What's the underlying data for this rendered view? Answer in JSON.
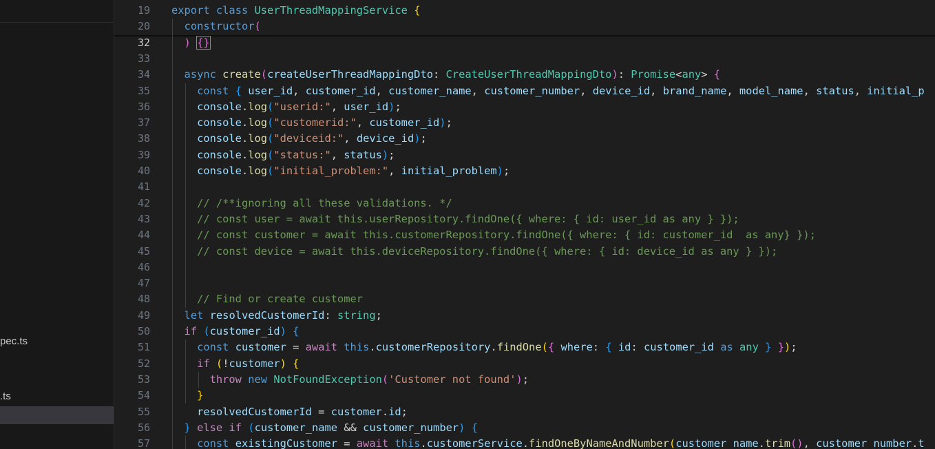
{
  "sidebar": {
    "items": [
      {
        "label": "pec.ts"
      },
      {
        "label": ".ts"
      }
    ]
  },
  "editor": {
    "lines": [
      {
        "num": "19",
        "tokens": [
          [
            "kw",
            "export"
          ],
          [
            "d",
            " "
          ],
          [
            "kw",
            "class"
          ],
          [
            "d",
            " "
          ],
          [
            "cls",
            "UserThreadMappingService"
          ],
          [
            "d",
            " "
          ],
          [
            "b1",
            "{"
          ]
        ]
      },
      {
        "num": "20",
        "tokens": [
          [
            "d",
            "  "
          ],
          [
            "kw",
            "constructor"
          ],
          [
            "b2",
            "("
          ]
        ]
      },
      {
        "num": "32",
        "active": true,
        "tokens": [
          [
            "d",
            "  "
          ],
          [
            "b2",
            ")"
          ],
          [
            "d",
            " "
          ],
          [
            "b2",
            "{}"
          ]
        ]
      },
      {
        "num": "33",
        "tokens": []
      },
      {
        "num": "34",
        "tokens": [
          [
            "d",
            "  "
          ],
          [
            "kw",
            "async"
          ],
          [
            "d",
            " "
          ],
          [
            "fn",
            "create"
          ],
          [
            "b2",
            "("
          ],
          [
            "var",
            "createUserThreadMappingDto"
          ],
          [
            "d",
            ": "
          ],
          [
            "cls",
            "CreateUserThreadMappingDto"
          ],
          [
            "b2",
            ")"
          ],
          [
            "d",
            ": "
          ],
          [
            "cls",
            "Promise"
          ],
          [
            "d",
            "<"
          ],
          [
            "cls",
            "any"
          ],
          [
            "d",
            "> "
          ],
          [
            "b2",
            "{"
          ]
        ]
      },
      {
        "num": "35",
        "tokens": [
          [
            "d",
            "    "
          ],
          [
            "kw",
            "const"
          ],
          [
            "d",
            " "
          ],
          [
            "b3",
            "{"
          ],
          [
            "d",
            " "
          ],
          [
            "var",
            "user_id"
          ],
          [
            "d",
            ", "
          ],
          [
            "var",
            "customer_id"
          ],
          [
            "d",
            ", "
          ],
          [
            "var",
            "customer_name"
          ],
          [
            "d",
            ", "
          ],
          [
            "var",
            "customer_number"
          ],
          [
            "d",
            ", "
          ],
          [
            "var",
            "device_id"
          ],
          [
            "d",
            ", "
          ],
          [
            "var",
            "brand_name"
          ],
          [
            "d",
            ", "
          ],
          [
            "var",
            "model_name"
          ],
          [
            "d",
            ", "
          ],
          [
            "var",
            "status"
          ],
          [
            "d",
            ", "
          ],
          [
            "var",
            "initial_p"
          ]
        ]
      },
      {
        "num": "36",
        "tokens": [
          [
            "d",
            "    "
          ],
          [
            "var",
            "console"
          ],
          [
            "d",
            "."
          ],
          [
            "fn",
            "log"
          ],
          [
            "b3",
            "("
          ],
          [
            "str",
            "\"userid:\""
          ],
          [
            "d",
            ", "
          ],
          [
            "var",
            "user_id"
          ],
          [
            "b3",
            ")"
          ],
          [
            "d",
            ";"
          ]
        ]
      },
      {
        "num": "37",
        "tokens": [
          [
            "d",
            "    "
          ],
          [
            "var",
            "console"
          ],
          [
            "d",
            "."
          ],
          [
            "fn",
            "log"
          ],
          [
            "b3",
            "("
          ],
          [
            "str",
            "\"customerid:\""
          ],
          [
            "d",
            ", "
          ],
          [
            "var",
            "customer_id"
          ],
          [
            "b3",
            ")"
          ],
          [
            "d",
            ";"
          ]
        ]
      },
      {
        "num": "38",
        "tokens": [
          [
            "d",
            "    "
          ],
          [
            "var",
            "console"
          ],
          [
            "d",
            "."
          ],
          [
            "fn",
            "log"
          ],
          [
            "b3",
            "("
          ],
          [
            "str",
            "\"deviceid:\""
          ],
          [
            "d",
            ", "
          ],
          [
            "var",
            "device_id"
          ],
          [
            "b3",
            ")"
          ],
          [
            "d",
            ";"
          ]
        ]
      },
      {
        "num": "39",
        "tokens": [
          [
            "d",
            "    "
          ],
          [
            "var",
            "console"
          ],
          [
            "d",
            "."
          ],
          [
            "fn",
            "log"
          ],
          [
            "b3",
            "("
          ],
          [
            "str",
            "\"status:\""
          ],
          [
            "d",
            ", "
          ],
          [
            "var",
            "status"
          ],
          [
            "b3",
            ")"
          ],
          [
            "d",
            ";"
          ]
        ]
      },
      {
        "num": "40",
        "tokens": [
          [
            "d",
            "    "
          ],
          [
            "var",
            "console"
          ],
          [
            "d",
            "."
          ],
          [
            "fn",
            "log"
          ],
          [
            "b3",
            "("
          ],
          [
            "str",
            "\"initial_problem:\""
          ],
          [
            "d",
            ", "
          ],
          [
            "var",
            "initial_problem"
          ],
          [
            "b3",
            ")"
          ],
          [
            "d",
            ";"
          ]
        ]
      },
      {
        "num": "41",
        "tokens": []
      },
      {
        "num": "42",
        "tokens": [
          [
            "d",
            "    "
          ],
          [
            "cmt",
            "// /**ignoring all these validations. */"
          ]
        ]
      },
      {
        "num": "43",
        "tokens": [
          [
            "d",
            "    "
          ],
          [
            "cmt",
            "// const user = await this.userRepository.findOne({ where: { id: user_id as any } });"
          ]
        ]
      },
      {
        "num": "44",
        "tokens": [
          [
            "d",
            "    "
          ],
          [
            "cmt",
            "// const customer = await this.customerRepository.findOne({ where: { id: customer_id  as any} });"
          ]
        ]
      },
      {
        "num": "45",
        "tokens": [
          [
            "d",
            "    "
          ],
          [
            "cmt",
            "// const device = await this.deviceRepository.findOne({ where: { id: device_id as any } });"
          ]
        ]
      },
      {
        "num": "46",
        "tokens": []
      },
      {
        "num": "47",
        "tokens": []
      },
      {
        "num": "48",
        "tokens": [
          [
            "d",
            "    "
          ],
          [
            "cmt",
            "// Find or create customer"
          ]
        ]
      },
      {
        "num": "49",
        "tokens": [
          [
            "d",
            "  "
          ],
          [
            "kw",
            "let"
          ],
          [
            "d",
            " "
          ],
          [
            "var",
            "resolvedCustomerId"
          ],
          [
            "d",
            ": "
          ],
          [
            "cls",
            "string"
          ],
          [
            "d",
            ";"
          ]
        ]
      },
      {
        "num": "50",
        "tokens": [
          [
            "d",
            "  "
          ],
          [
            "ctl",
            "if"
          ],
          [
            "d",
            " "
          ],
          [
            "b3",
            "("
          ],
          [
            "var",
            "customer_id"
          ],
          [
            "b3",
            ")"
          ],
          [
            "d",
            " "
          ],
          [
            "b3",
            "{"
          ]
        ]
      },
      {
        "num": "51",
        "tokens": [
          [
            "d",
            "    "
          ],
          [
            "kw",
            "const"
          ],
          [
            "d",
            " "
          ],
          [
            "var",
            "customer"
          ],
          [
            "d",
            " = "
          ],
          [
            "ctl",
            "await"
          ],
          [
            "d",
            " "
          ],
          [
            "kw",
            "this"
          ],
          [
            "d",
            "."
          ],
          [
            "var",
            "customerRepository"
          ],
          [
            "d",
            "."
          ],
          [
            "fn",
            "findOne"
          ],
          [
            "b1",
            "("
          ],
          [
            "b2",
            "{"
          ],
          [
            "d",
            " "
          ],
          [
            "var",
            "where"
          ],
          [
            "d",
            ": "
          ],
          [
            "b3",
            "{"
          ],
          [
            "d",
            " "
          ],
          [
            "var",
            "id"
          ],
          [
            "d",
            ": "
          ],
          [
            "var",
            "customer_id"
          ],
          [
            "d",
            " "
          ],
          [
            "kw",
            "as"
          ],
          [
            "d",
            " "
          ],
          [
            "cls",
            "any"
          ],
          [
            "d",
            " "
          ],
          [
            "b3",
            "}"
          ],
          [
            "d",
            " "
          ],
          [
            "b2",
            "}"
          ],
          [
            "b1",
            ")"
          ],
          [
            "d",
            ";"
          ]
        ]
      },
      {
        "num": "52",
        "tokens": [
          [
            "d",
            "    "
          ],
          [
            "ctl",
            "if"
          ],
          [
            "d",
            " "
          ],
          [
            "b1",
            "("
          ],
          [
            "d",
            "!"
          ],
          [
            "var",
            "customer"
          ],
          [
            "b1",
            ")"
          ],
          [
            "d",
            " "
          ],
          [
            "b1",
            "{"
          ]
        ]
      },
      {
        "num": "53",
        "tokens": [
          [
            "d",
            "      "
          ],
          [
            "ctl",
            "throw"
          ],
          [
            "d",
            " "
          ],
          [
            "kw",
            "new"
          ],
          [
            "d",
            " "
          ],
          [
            "cls",
            "NotFoundException"
          ],
          [
            "b2",
            "("
          ],
          [
            "str",
            "'Customer not found'"
          ],
          [
            "b2",
            ")"
          ],
          [
            "d",
            ";"
          ]
        ]
      },
      {
        "num": "54",
        "tokens": [
          [
            "d",
            "    "
          ],
          [
            "b1",
            "}"
          ]
        ]
      },
      {
        "num": "55",
        "tokens": [
          [
            "d",
            "    "
          ],
          [
            "var",
            "resolvedCustomerId"
          ],
          [
            "d",
            " = "
          ],
          [
            "var",
            "customer"
          ],
          [
            "d",
            "."
          ],
          [
            "var",
            "id"
          ],
          [
            "d",
            ";"
          ]
        ]
      },
      {
        "num": "56",
        "tokens": [
          [
            "d",
            "  "
          ],
          [
            "b3",
            "}"
          ],
          [
            "d",
            " "
          ],
          [
            "ctl",
            "else"
          ],
          [
            "d",
            " "
          ],
          [
            "ctl",
            "if"
          ],
          [
            "d",
            " "
          ],
          [
            "b3",
            "("
          ],
          [
            "var",
            "customer_name"
          ],
          [
            "d",
            " && "
          ],
          [
            "var",
            "customer_number"
          ],
          [
            "b3",
            ")"
          ],
          [
            "d",
            " "
          ],
          [
            "b3",
            "{"
          ]
        ]
      },
      {
        "num": "57",
        "tokens": [
          [
            "d",
            "    "
          ],
          [
            "kw",
            "const"
          ],
          [
            "d",
            " "
          ],
          [
            "var",
            "existingCustomer"
          ],
          [
            "d",
            " = "
          ],
          [
            "ctl",
            "await"
          ],
          [
            "d",
            " "
          ],
          [
            "kw",
            "this"
          ],
          [
            "d",
            "."
          ],
          [
            "var",
            "customerService"
          ],
          [
            "d",
            "."
          ],
          [
            "fn",
            "findOneByNameAndNumber"
          ],
          [
            "b1",
            "("
          ],
          [
            "var",
            "customer_name"
          ],
          [
            "d",
            "."
          ],
          [
            "fn",
            "trim"
          ],
          [
            "b2",
            "()"
          ],
          [
            "d",
            ", "
          ],
          [
            "var",
            "customer_number"
          ],
          [
            "d",
            "."
          ],
          [
            "var",
            "t"
          ]
        ]
      }
    ]
  }
}
